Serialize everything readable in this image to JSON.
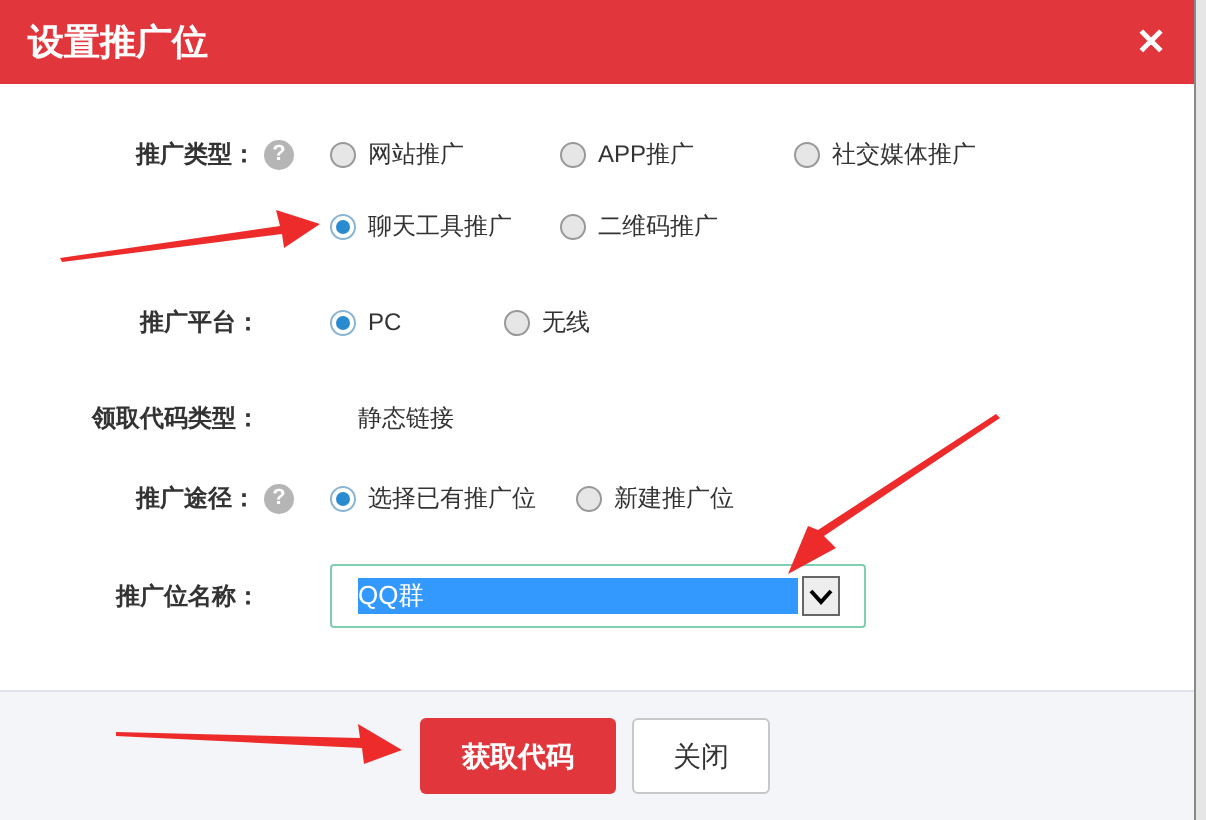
{
  "dialog": {
    "title": "设置推广位",
    "close": "✕"
  },
  "fields": [
    {
      "kind": "radio-grid",
      "label": "推广类型：",
      "help": "?",
      "options": [
        {
          "label": "网站推广",
          "selected": false
        },
        {
          "label": "APP推广",
          "selected": false
        },
        {
          "label": "社交媒体推广",
          "selected": false
        },
        {
          "label": "聊天工具推广",
          "selected": true
        },
        {
          "label": "二维码推广",
          "selected": false
        }
      ]
    },
    {
      "kind": "radio",
      "label": "推广平台：",
      "options": [
        {
          "label": "PC",
          "selected": true
        },
        {
          "label": "无线",
          "selected": false
        }
      ]
    },
    {
      "kind": "text",
      "label": "领取代码类型：",
      "value": "静态链接"
    },
    {
      "kind": "radio",
      "label": "推广途径：",
      "help": "?",
      "options": [
        {
          "label": "选择已有推广位",
          "selected": true
        },
        {
          "label": "新建推广位",
          "selected": false
        }
      ]
    },
    {
      "kind": "select",
      "label": "推广位名称：",
      "value": "QQ群",
      "highlighted": true
    }
  ],
  "buttons": [
    {
      "label": "获取代码",
      "kind": "primary"
    },
    {
      "label": "关闭",
      "kind": "secondary"
    }
  ]
}
